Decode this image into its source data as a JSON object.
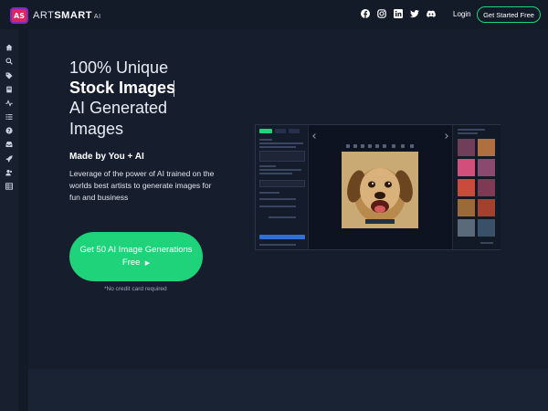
{
  "header": {
    "logo_text": "AS",
    "brand_part1": "ART",
    "brand_part2": "SMART",
    "brand_suffix": "AI",
    "social_icons": [
      "facebook-icon",
      "instagram-icon",
      "linkedin-icon",
      "twitter-icon",
      "discord-icon"
    ],
    "login_label": "Login",
    "cta_label": "Get Started Free"
  },
  "sidebar": {
    "icons": [
      "home-icon",
      "search-icon",
      "tag-icon",
      "book-icon",
      "activity-icon",
      "list-icon",
      "help-icon",
      "inbox-icon",
      "rocket-icon",
      "users-icon",
      "table-icon"
    ]
  },
  "hero": {
    "line1": "100% Unique",
    "line2": "Stock Images",
    "line3": "AI Generated",
    "line4": "Images",
    "made_by": "Made by You + AI",
    "description": "Leverage of the power of AI trained on the worlds best artists to generate images for fun and business",
    "cta_line1": "Get 50 AI Image Generations",
    "cta_line2": "Free",
    "cta_arrow": "▶",
    "note": "*No credit card required"
  },
  "colors": {
    "accent": "#1fd37a",
    "background": "#131a28",
    "panel": "#161e2e",
    "logo": "#e0245e"
  }
}
